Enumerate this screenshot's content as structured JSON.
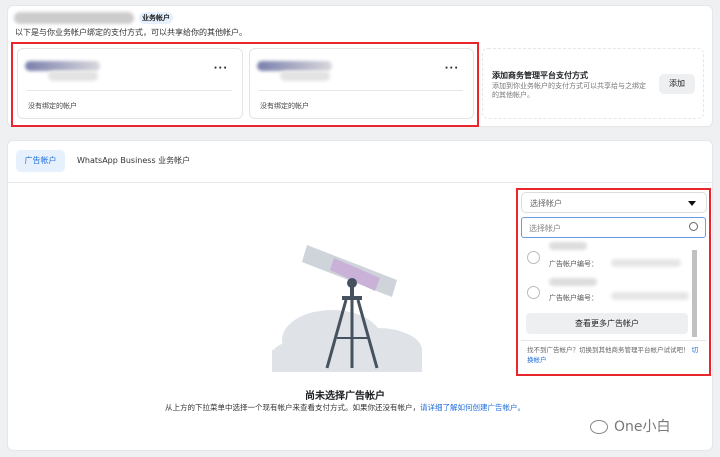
{
  "header": {
    "badge": "业务帐户",
    "description": "以下是与你业务帐户绑定的支付方式，可以共享给你的其他帐户。"
  },
  "payment_methods": [
    {
      "more": "···",
      "status": "没有绑定的帐户"
    },
    {
      "more": "···",
      "status": "没有绑定的帐户"
    }
  ],
  "add_panel": {
    "title": "添加商务管理平台支付方式",
    "description": "添加到你业务帐户的支付方式可以共享给与之绑定的其他帐户。",
    "button": "添加"
  },
  "tabs": [
    {
      "label": "广告帐户",
      "active": true
    },
    {
      "label": "WhatsApp Business 业务帐户",
      "active": false
    }
  ],
  "dropdown": {
    "selected_placeholder": "选择帐户",
    "search_placeholder": "选择帐户",
    "items": [
      {
        "id_label": "广告帐户编号："
      },
      {
        "id_label": "广告帐户编号："
      }
    ],
    "more_button": "查看更多广告帐户",
    "footer_text": "找不到广告帐户？切换到其他商务管理平台帐户试试吧！",
    "footer_link": "切换帐户"
  },
  "empty_state": {
    "title": "尚未选择广告帐户",
    "description": "从上方的下拉菜单中选择一个现有帐户来查看支付方式。如果你还没有帐户，",
    "link": "请详细了解如何创建广告帐户。"
  },
  "watermark": "One小白",
  "colors": {
    "accent": "#216fdb",
    "highlight": "#e8262b"
  }
}
